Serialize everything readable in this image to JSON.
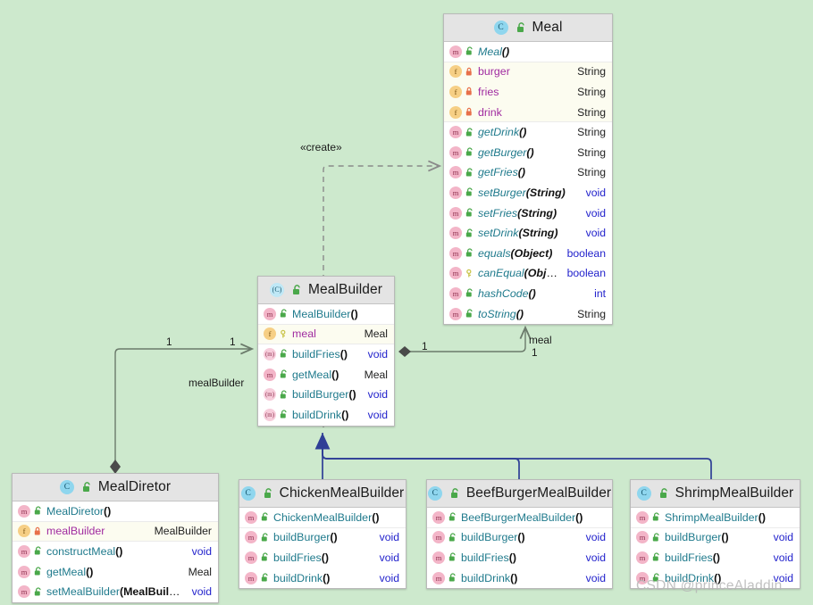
{
  "diagram": {
    "background": "#cde9cd",
    "watermark": "CSDN @princeAladdin"
  },
  "classes": {
    "meal": {
      "name": "Meal",
      "members": [
        {
          "kind": "ctor",
          "icon": "method-icon",
          "vis": "public",
          "name": "Meal",
          "args": "",
          "italic": true,
          "type": ""
        },
        {
          "kind": "field",
          "icon": "field-icon",
          "vis": "private",
          "name": "burger",
          "args": null,
          "italic": false,
          "type": "String"
        },
        {
          "kind": "field",
          "icon": "field-icon",
          "vis": "private",
          "name": "fries",
          "args": null,
          "italic": false,
          "type": "String"
        },
        {
          "kind": "field",
          "icon": "field-icon",
          "vis": "private",
          "name": "drink",
          "args": null,
          "italic": false,
          "type": "String"
        },
        {
          "kind": "method",
          "icon": "method-icon",
          "vis": "public",
          "name": "getDrink",
          "args": "",
          "italic": true,
          "type": "String"
        },
        {
          "kind": "method",
          "icon": "method-icon",
          "vis": "public",
          "name": "getBurger",
          "args": "",
          "italic": true,
          "type": "String"
        },
        {
          "kind": "method",
          "icon": "method-icon",
          "vis": "public",
          "name": "getFries",
          "args": "",
          "italic": true,
          "type": "String"
        },
        {
          "kind": "method",
          "icon": "method-icon",
          "vis": "public",
          "name": "setBurger",
          "args": "String",
          "italic": true,
          "type": "void"
        },
        {
          "kind": "method",
          "icon": "method-icon",
          "vis": "public",
          "name": "setFries",
          "args": "String",
          "italic": true,
          "type": "void"
        },
        {
          "kind": "method",
          "icon": "method-icon",
          "vis": "public",
          "name": "setDrink",
          "args": "String",
          "italic": true,
          "type": "void"
        },
        {
          "kind": "method",
          "icon": "method-icon",
          "vis": "public",
          "name": "equals",
          "args": "Object",
          "italic": true,
          "type": "boolean"
        },
        {
          "kind": "method",
          "icon": "method-icon",
          "vis": "protected",
          "name": "canEqual",
          "args": "Object",
          "italic": true,
          "type": "boolean"
        },
        {
          "kind": "method",
          "icon": "method-icon",
          "vis": "public",
          "name": "hashCode",
          "args": "",
          "italic": true,
          "type": "int"
        },
        {
          "kind": "method",
          "icon": "method-icon",
          "vis": "public",
          "name": "toString",
          "args": "",
          "italic": true,
          "type": "String"
        }
      ]
    },
    "mealbuilder": {
      "name": "MealBuilder",
      "abstract": true,
      "members": [
        {
          "kind": "ctor",
          "icon": "method-icon",
          "vis": "public",
          "name": "MealBuilder",
          "args": "",
          "italic": false,
          "type": ""
        },
        {
          "kind": "field",
          "icon": "field-icon",
          "vis": "protected",
          "name": "meal",
          "args": null,
          "italic": false,
          "type": "Meal"
        },
        {
          "kind": "method",
          "icon": "abstract-method-icon",
          "vis": "public",
          "name": "buildFries",
          "args": "",
          "italic": false,
          "type": "void"
        },
        {
          "kind": "method",
          "icon": "method-icon",
          "vis": "public",
          "name": "getMeal",
          "args": "",
          "italic": false,
          "type": "Meal"
        },
        {
          "kind": "method",
          "icon": "abstract-method-icon",
          "vis": "public",
          "name": "buildBurger",
          "args": "",
          "italic": false,
          "type": "void"
        },
        {
          "kind": "method",
          "icon": "abstract-method-icon",
          "vis": "public",
          "name": "buildDrink",
          "args": "",
          "italic": false,
          "type": "void"
        }
      ]
    },
    "mealdiretor": {
      "name": "MealDiretor",
      "members": [
        {
          "kind": "ctor",
          "icon": "method-icon",
          "vis": "public",
          "name": "MealDiretor",
          "args": "",
          "italic": false,
          "type": ""
        },
        {
          "kind": "field",
          "icon": "field-icon",
          "vis": "private",
          "name": "mealBuilder",
          "args": null,
          "italic": false,
          "type": "MealBuilder"
        },
        {
          "kind": "method",
          "icon": "method-icon",
          "vis": "public",
          "name": "constructMeal",
          "args": "",
          "italic": false,
          "type": "void"
        },
        {
          "kind": "method",
          "icon": "method-icon",
          "vis": "public",
          "name": "getMeal",
          "args": "",
          "italic": false,
          "type": "Meal"
        },
        {
          "kind": "method",
          "icon": "method-icon",
          "vis": "public",
          "name": "setMealBuilder",
          "args": "MealBuilder",
          "italic": false,
          "type": "void"
        }
      ]
    },
    "chicken": {
      "name": "ChickenMealBuilder",
      "members": [
        {
          "kind": "ctor",
          "icon": "method-icon",
          "vis": "public",
          "name": "ChickenMealBuilder",
          "args": "",
          "italic": false,
          "type": ""
        },
        {
          "kind": "method",
          "icon": "method-icon",
          "vis": "public",
          "name": "buildBurger",
          "args": "",
          "italic": false,
          "type": "void"
        },
        {
          "kind": "method",
          "icon": "method-icon",
          "vis": "public",
          "name": "buildFries",
          "args": "",
          "italic": false,
          "type": "void"
        },
        {
          "kind": "method",
          "icon": "method-icon",
          "vis": "public",
          "name": "buildDrink",
          "args": "",
          "italic": false,
          "type": "void"
        }
      ]
    },
    "beefburger": {
      "name": "BeefBurgerMealBuilder",
      "members": [
        {
          "kind": "ctor",
          "icon": "method-icon",
          "vis": "public",
          "name": "BeefBurgerMealBuilder",
          "args": "",
          "italic": false,
          "type": ""
        },
        {
          "kind": "method",
          "icon": "method-icon",
          "vis": "public",
          "name": "buildBurger",
          "args": "",
          "italic": false,
          "type": "void"
        },
        {
          "kind": "method",
          "icon": "method-icon",
          "vis": "public",
          "name": "buildFries",
          "args": "",
          "italic": false,
          "type": "void"
        },
        {
          "kind": "method",
          "icon": "method-icon",
          "vis": "public",
          "name": "buildDrink",
          "args": "",
          "italic": false,
          "type": "void"
        }
      ]
    },
    "shrimp": {
      "name": "ShrimpMealBuilder",
      "members": [
        {
          "kind": "ctor",
          "icon": "method-icon",
          "vis": "public",
          "name": "ShrimpMealBuilder",
          "args": "",
          "italic": false,
          "type": ""
        },
        {
          "kind": "method",
          "icon": "method-icon",
          "vis": "public",
          "name": "buildBurger",
          "args": "",
          "italic": false,
          "type": "void"
        },
        {
          "kind": "method",
          "icon": "method-icon",
          "vis": "public",
          "name": "buildFries",
          "args": "",
          "italic": false,
          "type": "void"
        },
        {
          "kind": "method",
          "icon": "method-icon",
          "vis": "public",
          "name": "buildDrink",
          "args": "",
          "italic": false,
          "type": "void"
        }
      ]
    }
  },
  "edges": {
    "create_stereotype": "«create»",
    "director_to_builder": {
      "label": "mealBuilder",
      "source_mult": "1",
      "target_mult": "1"
    },
    "builder_to_meal": {
      "label": "meal",
      "source_mult": "1",
      "target_mult": "1"
    }
  },
  "colors": {
    "background": "#cde9cd",
    "header_fill": "#e4e4e4",
    "field_row_fill": "#fcfcf0",
    "method_name": "#1f7a8c",
    "field_name": "#a02ba0",
    "keyword_type": "#2222cc",
    "inheritance_edge": "#2f3f96",
    "association_edge": "#6b7a6b"
  }
}
